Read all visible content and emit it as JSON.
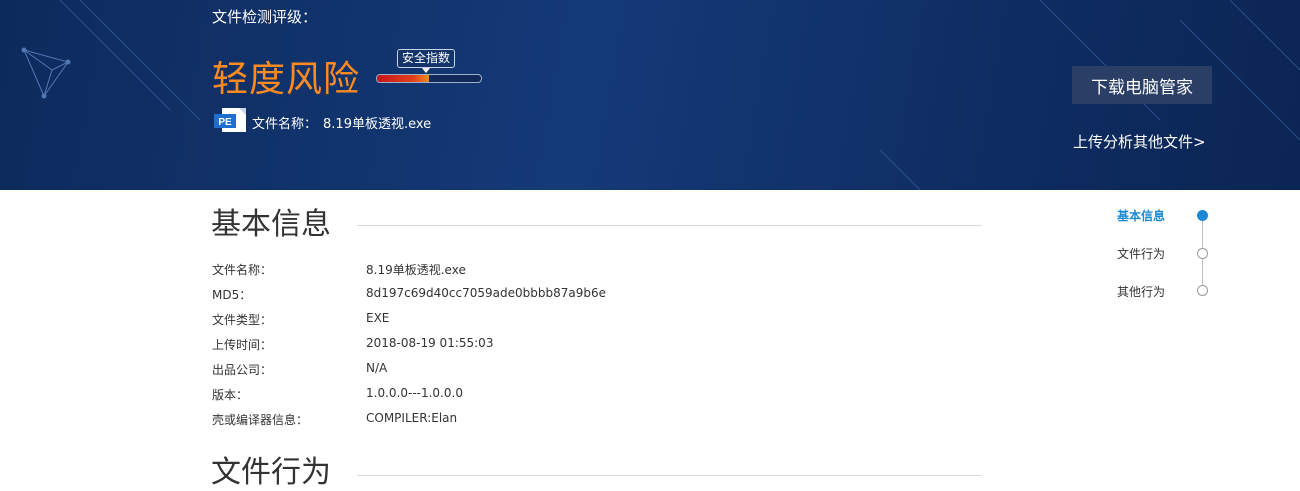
{
  "banner": {
    "rating_label": "文件检测评级：",
    "risk_level": "轻度风险",
    "safety_tag": "安全指数",
    "safety_level": 0.5,
    "pe_icon_text": "PE",
    "file_name_label": "文件名称：",
    "file_name_value": "8.19单板透视.exe",
    "download_button": "下载电脑管家",
    "upload_link": "上传分析其他文件>"
  },
  "basic_info": {
    "title": "基本信息",
    "rows": [
      {
        "key": "文件名称：",
        "value": "8.19单板透视.exe"
      },
      {
        "key": "MD5：",
        "value": "8d197c69d40cc7059ade0bbbb87a9b6e"
      },
      {
        "key": "文件类型：",
        "value": "EXE"
      },
      {
        "key": "上传时间：",
        "value": "2018-08-19 01:55:03"
      },
      {
        "key": "出品公司：",
        "value": "N/A"
      },
      {
        "key": "版本：",
        "value": "1.0.0.0---1.0.0.0"
      },
      {
        "key": "壳或编译器信息：",
        "value": "COMPILER:Elan"
      }
    ]
  },
  "file_behavior": {
    "title": "文件行为"
  },
  "side_nav": {
    "items": [
      {
        "label": "基本信息",
        "active": true
      },
      {
        "label": "文件行为",
        "active": false
      },
      {
        "label": "其他行为",
        "active": false
      }
    ]
  },
  "colors": {
    "banner_bg": "#12336c",
    "risk_orange": "#ff8a1f",
    "accent_blue": "#1a8ad8",
    "button_bg": "#2b3f66"
  }
}
